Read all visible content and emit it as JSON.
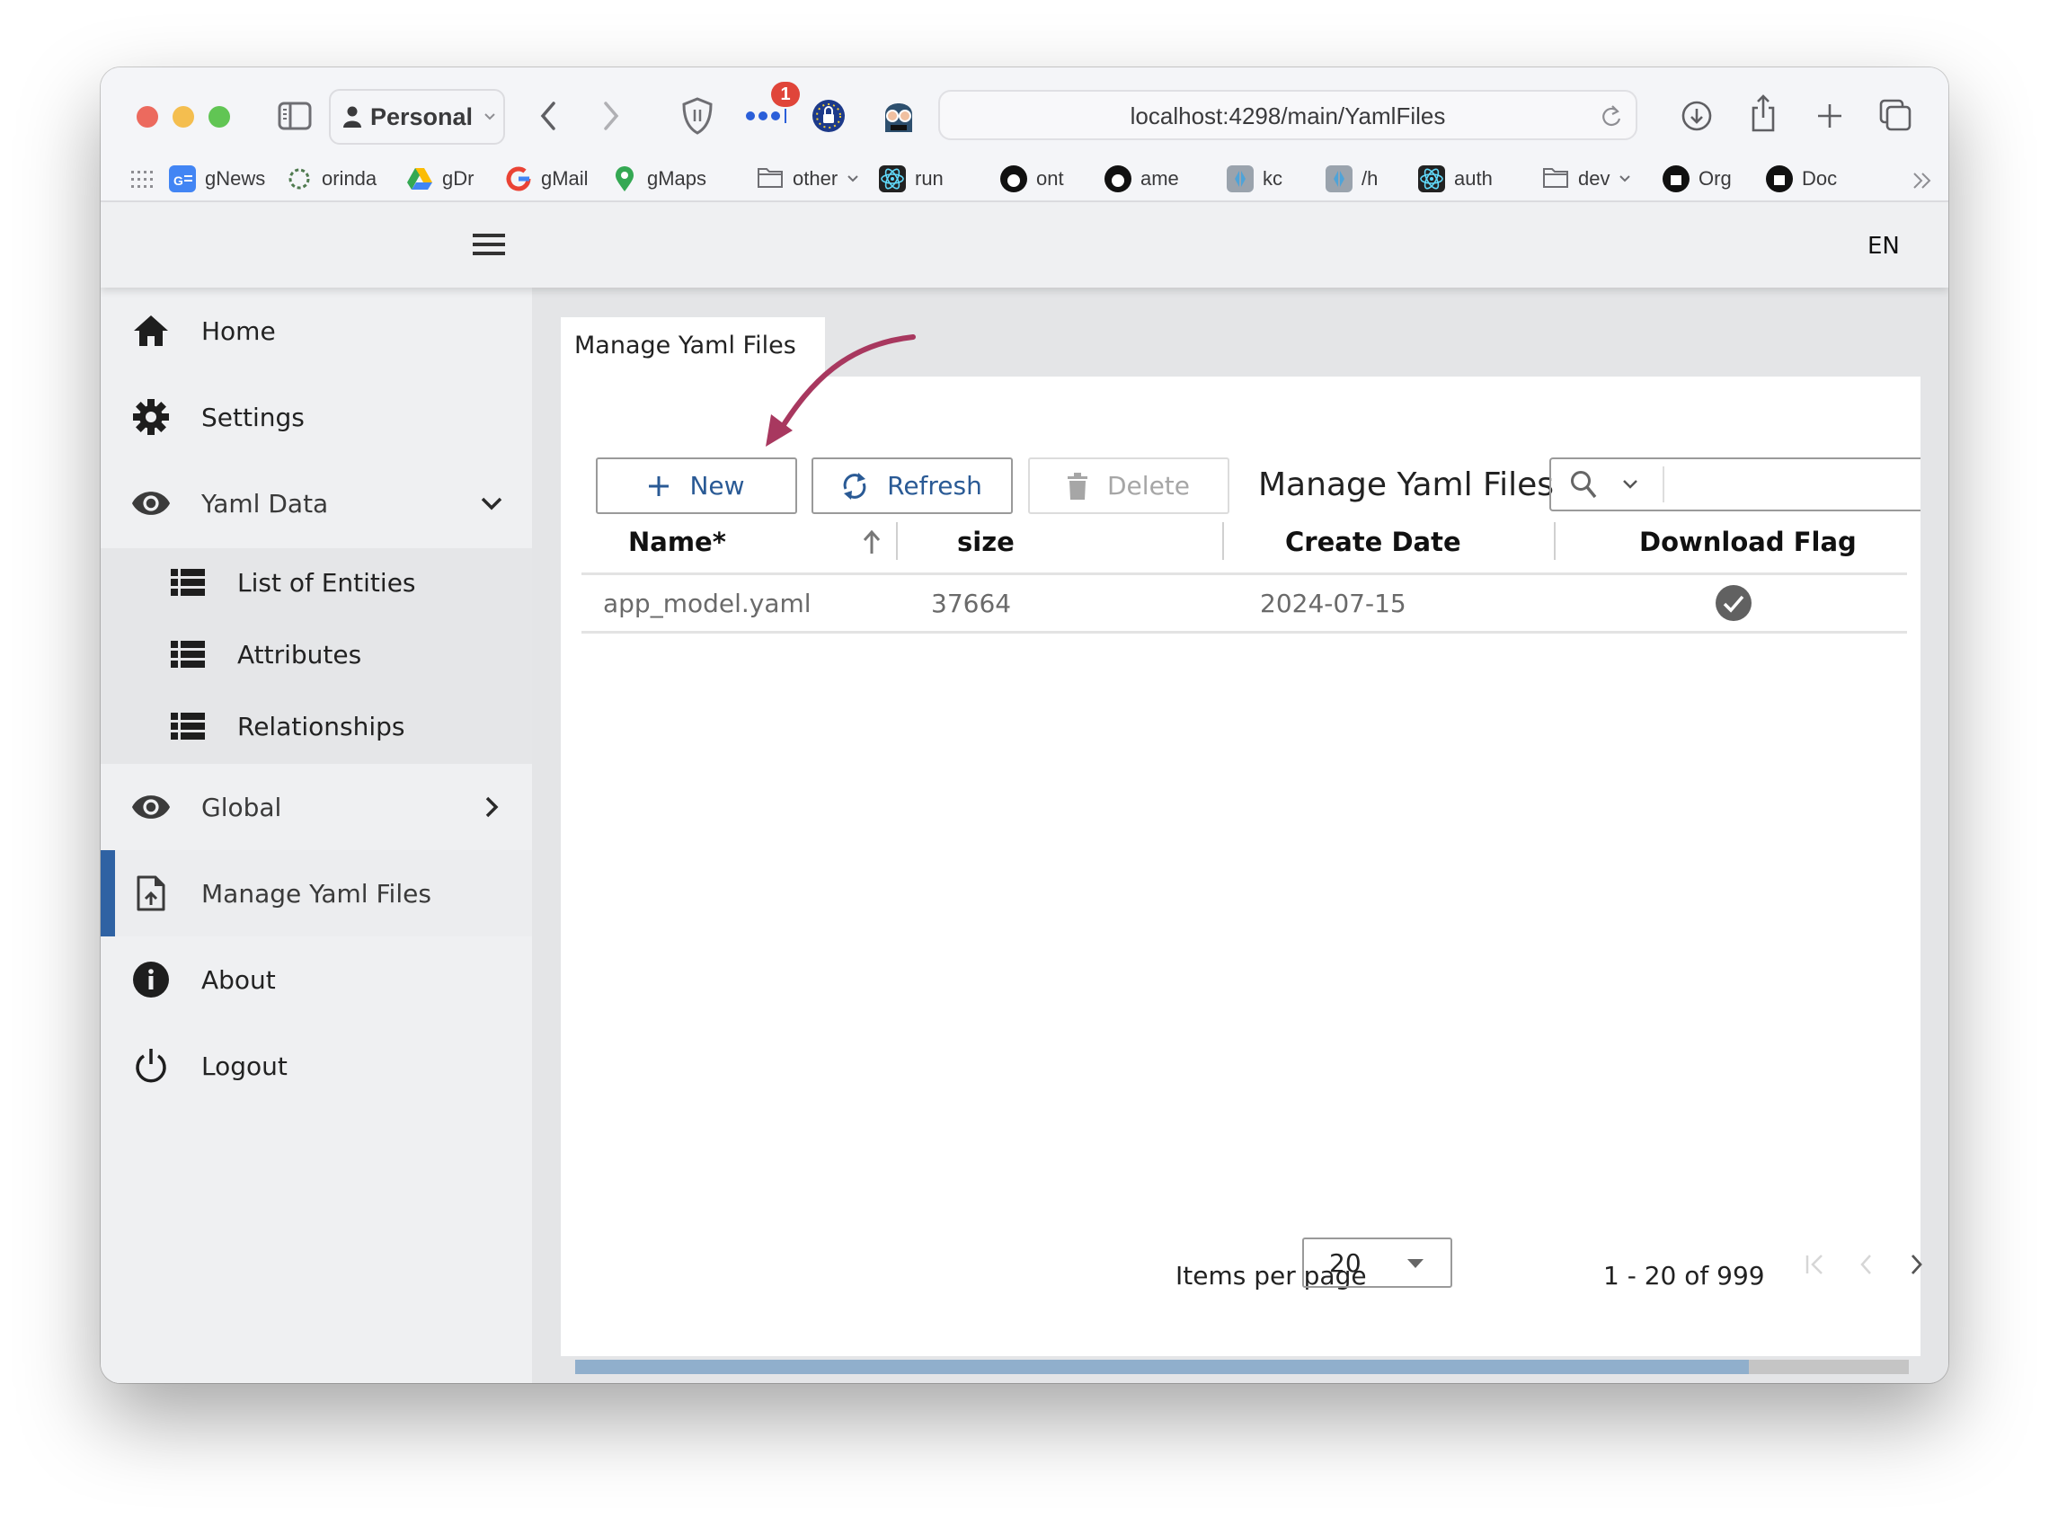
{
  "browser": {
    "profile_label": "Personal",
    "address": "localhost:4298/main/YamlFiles",
    "extension_badge": "1",
    "bookmarks": [
      {
        "label": "gNews",
        "icon": "google-news-icon",
        "color": "#4285f4"
      },
      {
        "label": "orinda",
        "icon": "orinda-icon",
        "color": "#4f7a4f"
      },
      {
        "label": "gDr",
        "icon": "google-drive-icon",
        "color": "#fbbc04"
      },
      {
        "label": "gMail",
        "icon": "google-icon",
        "color": "#ea4335"
      },
      {
        "label": "gMaps",
        "icon": "google-maps-icon",
        "color": "#34a853"
      },
      {
        "label": "other",
        "icon": "folder-icon",
        "color": "#6e6e73",
        "dropdown": true
      },
      {
        "label": "run",
        "icon": "react-icon",
        "color": "#222222"
      },
      {
        "label": "ont",
        "icon": "flame-icon",
        "color": "#111111"
      },
      {
        "label": "ame",
        "icon": "flame-icon",
        "color": "#111111"
      },
      {
        "label": "kc",
        "icon": "keycloak-icon",
        "color": "#4fa3d8"
      },
      {
        "label": "/h",
        "icon": "keycloak-icon",
        "color": "#4fa3d8"
      },
      {
        "label": "auth",
        "icon": "react-icon",
        "color": "#222222"
      },
      {
        "label": "dev",
        "icon": "folder-icon",
        "color": "#6e6e73",
        "dropdown": true
      },
      {
        "label": "Org",
        "icon": "github-icon",
        "color": "#111111"
      },
      {
        "label": "Doc",
        "icon": "doc-icon",
        "color": "#111111"
      }
    ]
  },
  "header": {
    "language": "EN"
  },
  "sidebar": {
    "items": [
      {
        "label": "Home",
        "icon": "home-icon"
      },
      {
        "label": "Settings",
        "icon": "gear-icon"
      },
      {
        "label": "Yaml Data",
        "icon": "eye-icon",
        "expanded": true
      },
      {
        "label": "Global",
        "icon": "eye-icon",
        "expanded": false
      },
      {
        "label": "Manage Yaml Files",
        "icon": "file-upload-icon",
        "active": true
      },
      {
        "label": "About",
        "icon": "info-icon"
      },
      {
        "label": "Logout",
        "icon": "power-icon"
      }
    ],
    "submenu": [
      {
        "label": "List of Entities",
        "icon": "list-icon"
      },
      {
        "label": "Attributes",
        "icon": "list-icon"
      },
      {
        "label": "Relationships",
        "icon": "list-icon"
      }
    ],
    "active_color": "#2f62a3"
  },
  "main": {
    "tab_label": "Manage Yaml Files",
    "toolbar": {
      "new_label": "New",
      "refresh_label": "Refresh",
      "delete_label": "Delete",
      "grid_title": "Manage Yaml Files",
      "search_value": ""
    },
    "table": {
      "columns": [
        "Name*",
        "size",
        "Create Date",
        "Download Flag"
      ],
      "sort": {
        "column": "Name*",
        "direction": "ascending"
      },
      "rows": [
        {
          "name": "app_model.yaml",
          "size": "37664",
          "create_date": "2024-07-15",
          "download_flag": true
        }
      ]
    },
    "paginator": {
      "items_per_page_label": "Items per page",
      "items_per_page": "20",
      "range_label": "1 - 20 of 999"
    },
    "progress": {
      "fraction": 0.88,
      "color": "#90afcc"
    }
  },
  "annotation": {
    "type": "arrow",
    "target": "new-button",
    "color": "#a8385f"
  }
}
